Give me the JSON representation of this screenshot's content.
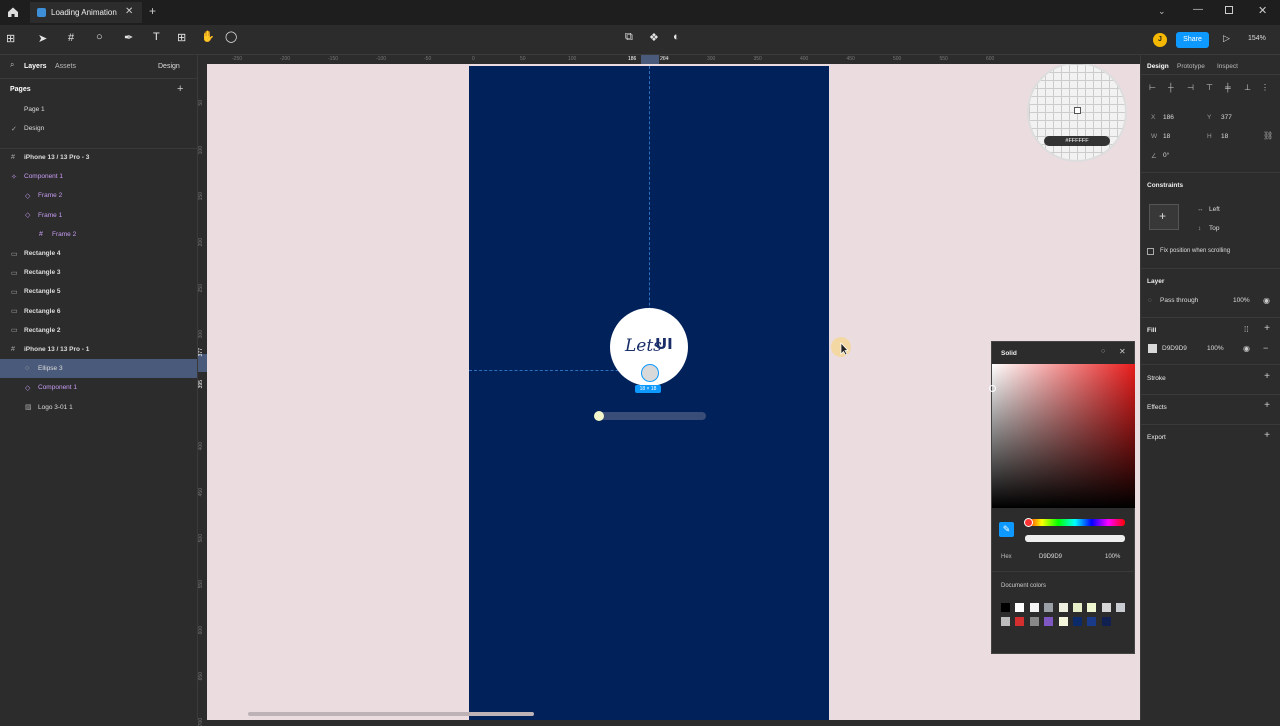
{
  "titlebar": {
    "tab_title": "Loading Animation",
    "new_tab": "+"
  },
  "toolbar": {
    "avatar_initial": "J",
    "share_label": "Share",
    "zoom_label": "154%"
  },
  "left_panel": {
    "tabs": {
      "layers": "Layers",
      "assets": "Assets",
      "page_select": "Design"
    },
    "pages_title": "Pages",
    "pages": [
      {
        "label": "Page 1",
        "selected": false
      },
      {
        "label": "Design",
        "selected": true
      }
    ],
    "layers": [
      {
        "label": "iPhone 13 / 13 Pro - 3",
        "icon": "frame-icon",
        "glyph": "#",
        "indent": 0,
        "purple": false,
        "selected": false
      },
      {
        "label": "Component 1",
        "icon": "component-icon",
        "glyph": "✧",
        "indent": 0,
        "purple": true,
        "selected": false
      },
      {
        "label": "Frame 2",
        "icon": "variant-icon",
        "glyph": "◇",
        "indent": 1,
        "purple": true,
        "selected": false
      },
      {
        "label": "Frame 1",
        "icon": "variant-icon",
        "glyph": "◇",
        "indent": 1,
        "purple": true,
        "selected": false
      },
      {
        "label": "Frame 2",
        "icon": "frame-icon",
        "glyph": "#",
        "indent": 2,
        "purple": true,
        "selected": false
      },
      {
        "label": "Rectangle 4",
        "icon": "rectangle-icon",
        "glyph": "▭",
        "indent": 0,
        "purple": false,
        "selected": false
      },
      {
        "label": "Rectangle 3",
        "icon": "rectangle-icon",
        "glyph": "▭",
        "indent": 0,
        "purple": false,
        "selected": false
      },
      {
        "label": "Rectangle 5",
        "icon": "rectangle-icon",
        "glyph": "▭",
        "indent": 0,
        "purple": false,
        "selected": false
      },
      {
        "label": "Rectangle 6",
        "icon": "rectangle-icon",
        "glyph": "▭",
        "indent": 0,
        "purple": false,
        "selected": false
      },
      {
        "label": "Rectangle 2",
        "icon": "rectangle-icon",
        "glyph": "▭",
        "indent": 0,
        "purple": false,
        "selected": false
      },
      {
        "label": "iPhone 13 / 13 Pro - 1",
        "icon": "frame-icon",
        "glyph": "#",
        "indent": 0,
        "purple": false,
        "selected": false
      },
      {
        "label": "Ellipse 3",
        "icon": "ellipse-icon",
        "glyph": "○",
        "indent": 1,
        "purple": false,
        "selected": true
      },
      {
        "label": "Component 1",
        "icon": "instance-icon",
        "glyph": "◇",
        "indent": 1,
        "purple": true,
        "selected": false
      },
      {
        "label": "Logo 3-01 1",
        "icon": "image-icon",
        "glyph": "▨",
        "indent": 1,
        "purple": false,
        "selected": false
      }
    ]
  },
  "canvas": {
    "logo_text_script": "Lets",
    "logo_text_bold": "UI",
    "selection_size": "18 × 18",
    "ruler_marks_top": [
      "-250",
      "-200",
      "-150",
      "-100",
      "-50",
      "0",
      "50",
      "100",
      "186",
      "204",
      "250",
      "300",
      "350",
      "400",
      "450",
      "500",
      "550",
      "600"
    ],
    "ruler_marks_left": [
      "50",
      "100",
      "150",
      "200",
      "250",
      "300",
      "377",
      "395",
      "400",
      "450",
      "500",
      "550",
      "600",
      "650",
      "700"
    ],
    "loupe_hex": "#FFFFFF"
  },
  "right_panel": {
    "tabs": [
      "Design",
      "Prototype",
      "Inspect"
    ],
    "x_label": "X",
    "x_value": "186",
    "y_label": "Y",
    "y_value": "377",
    "w_label": "W",
    "w_value": "18",
    "h_label": "H",
    "h_value": "18",
    "rotation": "0°",
    "constraints_title": "Constraints",
    "constraint_h": "Left",
    "constraint_v": "Top",
    "fix_position_label": "Fix position when scrolling",
    "layer_title": "Layer",
    "blend_mode": "Pass through",
    "layer_opacity": "100%",
    "fill_title": "Fill",
    "fill_hex": "D9D9D9",
    "fill_opacity": "100%",
    "stroke_title": "Stroke",
    "effects_title": "Effects",
    "export_title": "Export"
  },
  "color_picker": {
    "mode": "Solid",
    "hex_label": "Hex",
    "hex_value": "D9D9D9",
    "opacity": "100%",
    "doc_colors_title": "Document colors",
    "doc_colors": [
      "#000000",
      "#ffffff",
      "#f4f4f4",
      "#9aa0a6",
      "#f0f0e0",
      "#e7efc9",
      "#eef7d0",
      "#d6d6d6",
      "#c8ccd0",
      "#bdbdbd",
      "#d32f2f",
      "#888888",
      "#7e57c2",
      "#f5f5dc",
      "#0a2a6a",
      "#1a3a8a",
      "#102050"
    ]
  },
  "colors": {
    "accent_blue": "#0d99ff",
    "artboard_navy": "#00215a",
    "canvas_bg": "#ebdce0",
    "selection_row": "#4a5a7a",
    "component_purple": "#c79df5"
  }
}
